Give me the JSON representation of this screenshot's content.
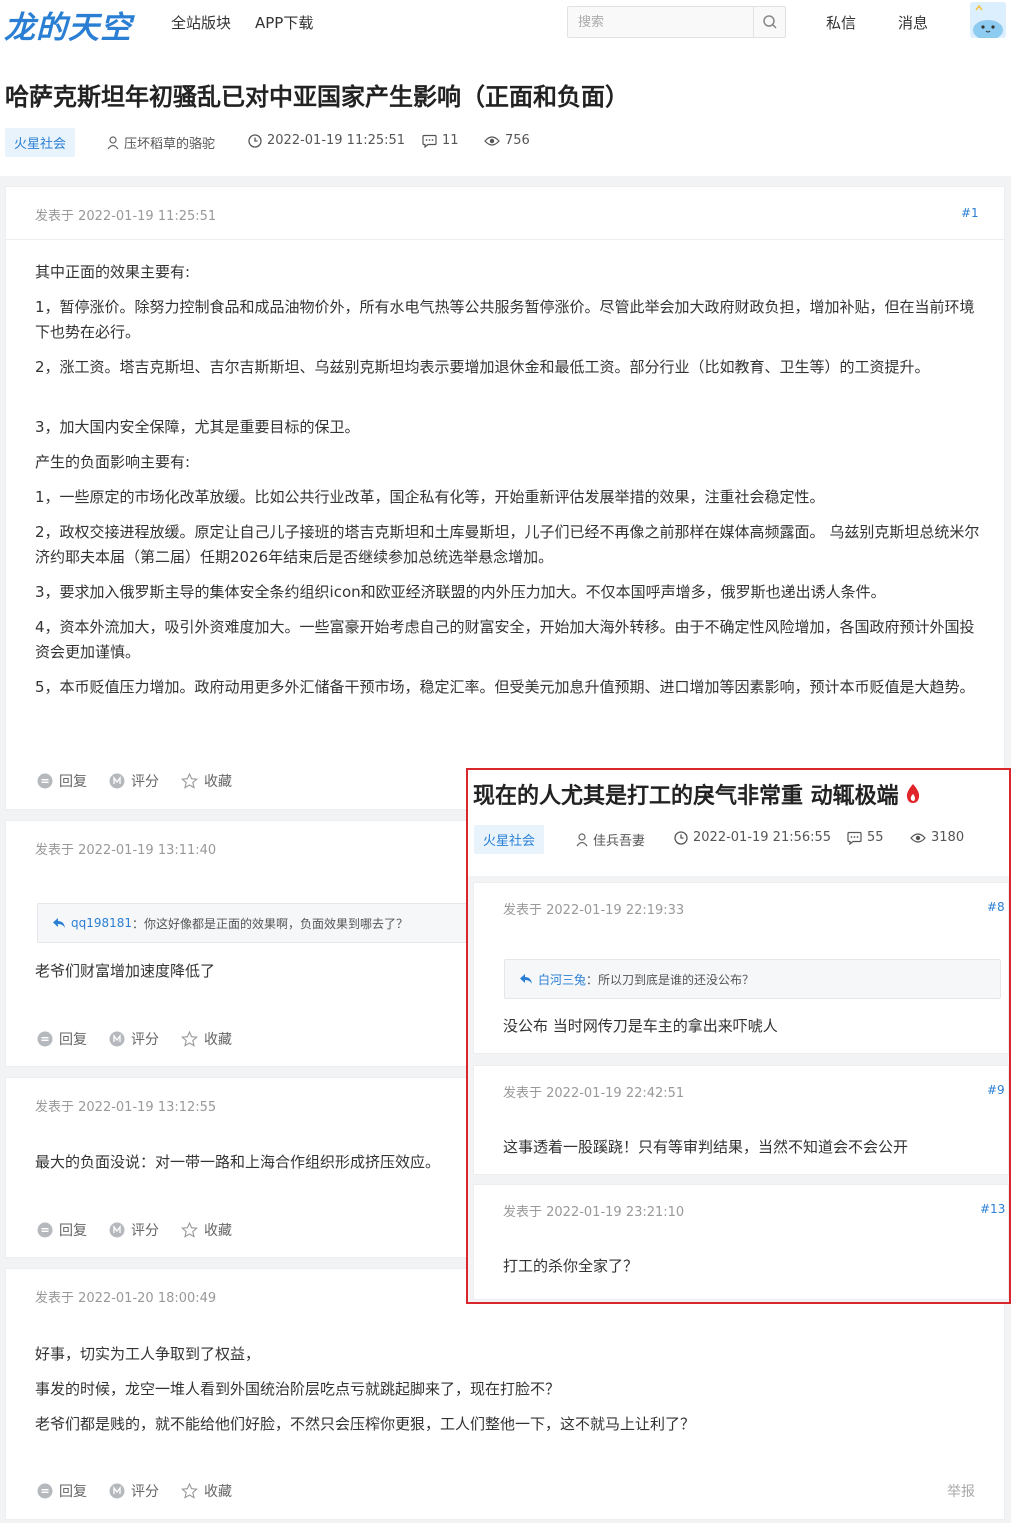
{
  "header": {
    "logo": "龙的天空",
    "nav": [
      "全站版块",
      "APP下载"
    ],
    "search_placeholder": "搜索",
    "user_links": [
      "私信",
      "消息"
    ],
    "accent": "#2a7fd4"
  },
  "thread": {
    "title": "哈萨克斯坦年初骚乱已对中亚国家产生影响（正面和负面）",
    "tag": "火星社会",
    "author": "压坏稻草的骆驼",
    "datetime": "2022-01-19 11:25:51",
    "comments": "11",
    "views": "756"
  },
  "actions": {
    "reply": "回复",
    "rate": "评分",
    "favorite": "收藏",
    "report": "举报"
  },
  "posts": [
    {
      "date": "发表于 2022-01-19 11:25:51",
      "floor": "#1",
      "paragraphs": [
        "其中正面的效果主要有:",
        "1，暂停涨价。除努力控制食品和成品油物价外，所有水电气热等公共服务暂停涨价。尽管此举会加大政府财政负担，增加补贴，但在当前环境下也势在必行。",
        "2，涨工资。塔吉克斯坦、吉尔吉斯斯坦、乌兹别克斯坦均表示要增加退休金和最低工资。部分行业（比如教育、卫生等）的工资提升。",
        "3，加大国内安全保障，尤其是重要目标的保卫。",
        "产生的负面影响主要有:",
        "1，一些原定的市场化改革放缓。比如公共行业改革，国企私有化等，开始重新评估发展举措的效果，注重社会稳定性。",
        "2，政权交接进程放缓。原定让自己儿子接班的塔吉克斯坦和土库曼斯坦，儿子们已经不再像之前那样在媒体高频露面。 乌兹别克斯坦总统米尔济约耶夫本届（第二届）任期2026年结束后是否继续参加总统选举悬念增加。",
        "3，要求加入俄罗斯主导的集体安全条约组织icon和欧亚经济联盟的内外压力加大。不仅本国呼声增多，俄罗斯也递出诱人条件。",
        "4，资本外流加大，吸引外资难度加大。一些富豪开始考虑自己的财富安全，开始加大海外转移。由于不确定性风险增加，各国政府预计外国投资会更加谨慎。",
        "5，本币贬值压力增加。政府动用更多外汇储备干预市场，稳定汇率。但受美元加息升值预期、进口增加等因素影响，预计本币贬值是大趋势。"
      ]
    },
    {
      "date": "发表于 2022-01-19 13:11:40",
      "quote_user": "qq198181",
      "quote_text": "：你这好像都是正面的效果啊，负面效果到哪去了？",
      "text": "老爷们财富增加速度降低了"
    },
    {
      "date": "发表于 2022-01-19 13:12:55",
      "text": "最大的负面没说：对一带一路和上海合作组织形成挤压效应。"
    },
    {
      "date": "发表于 2022-01-20 18:00:49",
      "paragraphs": [
        "好事，切实为工人争取到了权益，",
        "事发的时候，龙空一堆人看到外国统治阶层吃点亏就跳起脚来了，现在打脸不？",
        "老爷们都是贱的，就不能给他们好脸，不然只会压榨你更狠，工人们整他一下，这不就马上让利了？"
      ]
    }
  ],
  "overlay": {
    "title": "现在的人尤其是打工的戾气非常重 动辄极端",
    "tag": "火星社会",
    "author": "佳兵吾妻",
    "datetime": "2022-01-19 21:56:55",
    "comments": "55",
    "views": "3180",
    "border_color": "#d9262c",
    "posts": [
      {
        "date": "发表于 2022-01-19 22:19:33",
        "floor": "#8",
        "quote_user": "白河三兔",
        "quote_text": "：所以刀到底是谁的还没公布？",
        "text": "没公布 当时网传刀是车主的拿出来吓唬人"
      },
      {
        "date": "发表于 2022-01-19 22:42:51",
        "floor": "#9",
        "text": "这事透着一股蹊跷！只有等审判结果，当然不知道会不会公开"
      },
      {
        "date": "发表于 2022-01-19 23:21:10",
        "floor": "#13",
        "text": "打工的杀你全家了？"
      }
    ]
  }
}
